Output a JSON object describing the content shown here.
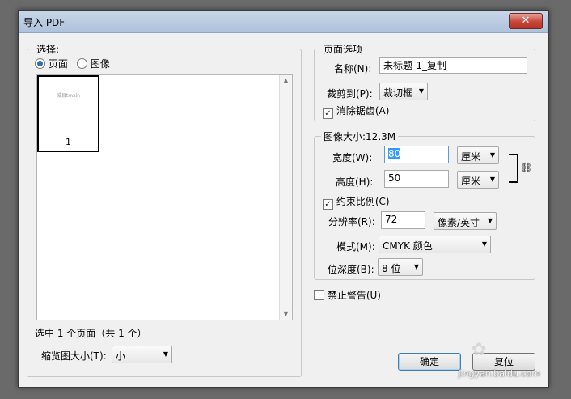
{
  "window": {
    "title": "导入 PDF",
    "close_symbol": "✕"
  },
  "select_group": {
    "legend": "选择:",
    "radio_page": "页面",
    "radio_image": "图像",
    "thumbnail": {
      "text": "城县tmxin",
      "page_number": "1"
    },
    "status": "选中 1 个页面（共 1 个）",
    "thumb_size_label": "缩览图大小(T):",
    "thumb_size_value": "小"
  },
  "page_options": {
    "legend": "页面选项",
    "name_label": "名称(N):",
    "name_value": "未标题-1_复制",
    "crop_label": "裁剪到(P):",
    "crop_value": "裁切框",
    "antialias_label": "消除锯齿(A)",
    "antialias_checked": true
  },
  "image_size": {
    "legend": "图像大小:12.3M",
    "width_label": "宽度(W):",
    "width_value": "80",
    "width_unit": "厘米",
    "height_label": "高度(H):",
    "height_value": "50",
    "height_unit": "厘米",
    "constrain_label": "约束比例(C)",
    "constrain_checked": true,
    "resolution_label": "分辨率(R):",
    "resolution_value": "72",
    "resolution_unit": "像素/英寸",
    "mode_label": "模式(M):",
    "mode_value": "CMYK 颜色",
    "depth_label": "位深度(B):",
    "depth_value": "8 位"
  },
  "suppress_warnings_label": "禁止警告(U)",
  "buttons": {
    "ok": "确定",
    "cancel": "复位"
  },
  "watermark": "jingyan.baidu.com",
  "icons": {
    "link": "link-chain-icon",
    "caret": "▼"
  }
}
